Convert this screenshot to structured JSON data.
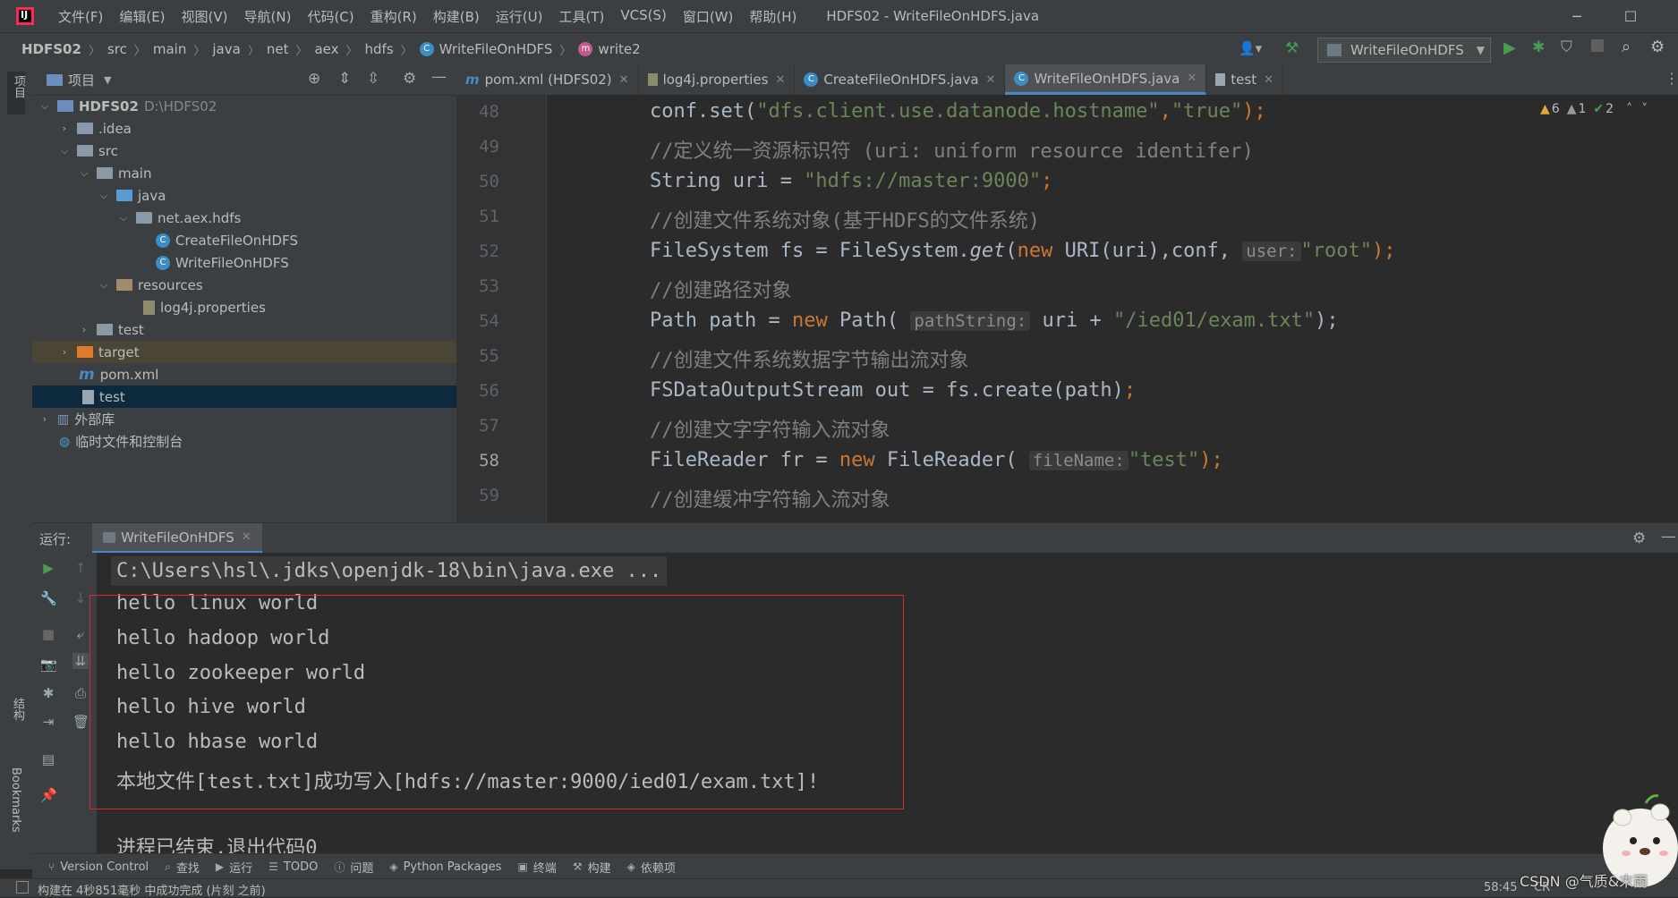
{
  "window": {
    "title": "HDFS02 - WriteFileOnHDFS.java",
    "menu": [
      "文件(F)",
      "编辑(E)",
      "视图(V)",
      "导航(N)",
      "代码(C)",
      "重构(R)",
      "构建(B)",
      "运行(U)",
      "工具(T)",
      "VCS(S)",
      "窗口(W)",
      "帮助(H)"
    ]
  },
  "breadcrumb": [
    "HDFS02",
    "src",
    "main",
    "java",
    "net",
    "aex",
    "hdfs",
    "WriteFileOnHDFS",
    "write2"
  ],
  "toolbar": {
    "run_config": "WriteFileOnHDFS"
  },
  "project": {
    "header": "项目",
    "tree": [
      {
        "label": "HDFS02",
        "extra": "D:\\HDFS02",
        "depth": 0,
        "kind": "module",
        "open": true
      },
      {
        "label": ".idea",
        "depth": 1,
        "kind": "folder",
        "open": false
      },
      {
        "label": "src",
        "depth": 1,
        "kind": "folder",
        "open": true
      },
      {
        "label": "main",
        "depth": 2,
        "kind": "folder",
        "open": true
      },
      {
        "label": "java",
        "depth": 3,
        "kind": "source-folder",
        "open": true
      },
      {
        "label": "net.aex.hdfs",
        "depth": 4,
        "kind": "package",
        "open": true
      },
      {
        "label": "CreateFileOnHDFS",
        "depth": 5,
        "kind": "class"
      },
      {
        "label": "WriteFileOnHDFS",
        "depth": 5,
        "kind": "class"
      },
      {
        "label": "resources",
        "depth": 3,
        "kind": "resource-folder",
        "open": true
      },
      {
        "label": "log4j.properties",
        "depth": 4,
        "kind": "file"
      },
      {
        "label": "test",
        "depth": 2,
        "kind": "folder",
        "open": false
      },
      {
        "label": "target",
        "depth": 1,
        "kind": "target-folder",
        "open": false
      },
      {
        "label": "pom.xml",
        "depth": 1,
        "kind": "maven"
      },
      {
        "label": "test",
        "depth": 1,
        "kind": "file",
        "selected": true
      },
      {
        "label": "外部库",
        "depth": 0,
        "kind": "library",
        "open": false
      },
      {
        "label": "临时文件和控制台",
        "depth": 0,
        "kind": "scratch"
      }
    ]
  },
  "tabs": [
    {
      "label": "pom.xml (HDFS02)",
      "icon": "maven-icon"
    },
    {
      "label": "log4j.properties",
      "icon": "properties-icon"
    },
    {
      "label": "CreateFileOnHDFS.java",
      "icon": "class-icon"
    },
    {
      "label": "WriteFileOnHDFS.java",
      "icon": "class-icon",
      "active": true
    },
    {
      "label": "test",
      "icon": "file-icon"
    }
  ],
  "inspections": {
    "warnings": "6",
    "weak_warnings": "1",
    "ok": "2"
  },
  "code": {
    "line_numbers": [
      "48",
      "49",
      "50",
      "51",
      "52",
      "53",
      "54",
      "55",
      "56",
      "57",
      "58",
      "59"
    ],
    "current_line": "58",
    "l48": {
      "a": "conf.set(",
      "s1": "\"dfs.client.use.datanode.hostname\"",
      "c": ",",
      "s2": "\"true\"",
      "e": ");"
    },
    "l49": "//定义统一资源标识符 (uri: uniform resource identifer)",
    "l50": {
      "a": "String uri = ",
      "s": "\"hdfs://master:9000\"",
      "e": ";"
    },
    "l51": "//创建文件系统对象(基于HDFS的文件系统)",
    "l52": {
      "a": "FileSystem fs = FileSystem.",
      "m": "get",
      "b": "(",
      "k": "new",
      "c": " URI(uri),conf, ",
      "h": "user:",
      "s": "\"root\"",
      "e": ");"
    },
    "l53": "//创建路径对象",
    "l54": {
      "a": "Path path = ",
      "k": "new",
      "b": " Path( ",
      "h": "pathString:",
      "c": " uri + ",
      "s": "\"/ied01/exam.txt\"",
      "e": ");"
    },
    "l55": "//创建文件系统数据字节输出流对象",
    "l56": {
      "a": "FSDataOutputStream out = fs.create(path)",
      "e": ";"
    },
    "l57": "//创建文字字符输入流对象",
    "l58": {
      "a": "FileReader fr = ",
      "k": "new",
      "b": " FileReader( ",
      "h": "fileName:",
      "s": "\"test\"",
      "e": ");"
    },
    "l59": "//创建缓冲字符输入流对象"
  },
  "run": {
    "label": "运行:",
    "tab": "WriteFileOnHDFS",
    "command": "C:\\Users\\hsl\\.jdks\\openjdk-18\\bin\\java.exe ...",
    "output": [
      "hello linux world",
      "hello hadoop world",
      "hello zookeeper world",
      "hello hive world",
      "hello hbase world",
      "本地文件[test.txt]成功写入[hdfs://master:9000/ied01/exam.txt]!"
    ],
    "exit": "进程已结束,退出代码0"
  },
  "bottom_tools": [
    {
      "label": "Version Control",
      "icon": "branch-icon"
    },
    {
      "label": "查找",
      "icon": "search-icon"
    },
    {
      "label": "运行",
      "icon": "run-icon"
    },
    {
      "label": "TODO",
      "icon": "list-icon"
    },
    {
      "label": "问题",
      "icon": "info-icon"
    },
    {
      "label": "Python Packages",
      "icon": "layers-icon"
    },
    {
      "label": "终端",
      "icon": "terminal-icon"
    },
    {
      "label": "构建",
      "icon": "hammer-icon"
    },
    {
      "label": "依赖项",
      "icon": "layers-icon"
    }
  ],
  "status": {
    "message": "构建在 4秒851毫秒 中成功完成 (片刻 之前)",
    "position": "58:45",
    "line_sep": "CR",
    "watermark": "CSDN @气质&末雨"
  },
  "side_labels": {
    "project": "项目",
    "structure": "结构",
    "bookmarks": "Bookmarks"
  },
  "colors": {
    "bg": "#2b2b2b",
    "panel": "#3c3f41",
    "keyword": "#cc7832",
    "string": "#6a8759",
    "comment": "#808080",
    "selection": "#0d293e",
    "highlight_box": "#d42b2b",
    "run_green": "#499c54"
  }
}
